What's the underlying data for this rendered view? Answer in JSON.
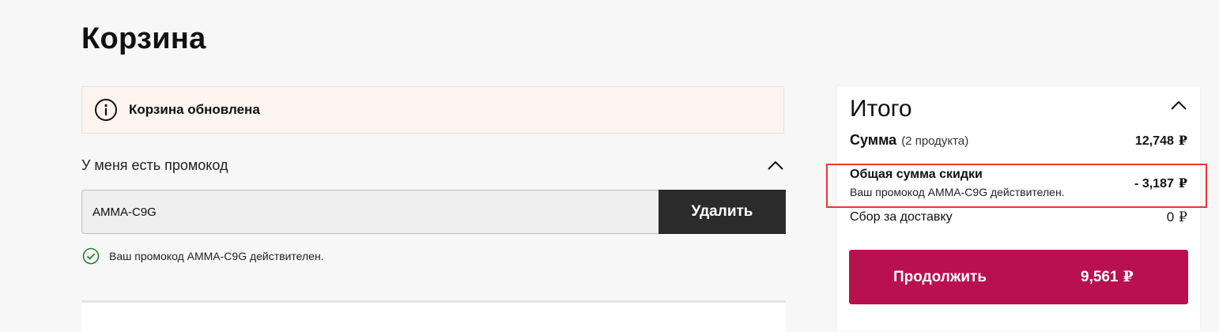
{
  "page": {
    "title": "Корзина"
  },
  "notice": {
    "text": "Корзина обновлена",
    "icon": "info-icon"
  },
  "promo": {
    "toggle_label": "У меня есть промокод",
    "input_value": "AMMA-C9G",
    "remove_label": "Удалить",
    "valid_message": "Ваш промокод AMMA-C9G действителен."
  },
  "summary": {
    "title": "Итого",
    "subtotal_label": "Сумма",
    "subtotal_count": "(2 продукта)",
    "subtotal_amount": "12,748",
    "discount_label": "Общая сумма скидки",
    "discount_note": "Ваш промокод AMMA-C9G действителен.",
    "discount_amount": "- 3,187",
    "delivery_label": "Сбор за доставку",
    "delivery_amount": "0",
    "currency": "₽",
    "continue_label": "Продолжить",
    "continue_total": "9,561"
  },
  "colors": {
    "accent": "#b9104f",
    "dark_button": "#2b2b2b",
    "notice_bg": "#fdf4ef",
    "highlight_border": "#e53935",
    "success": "#2e7d32"
  }
}
